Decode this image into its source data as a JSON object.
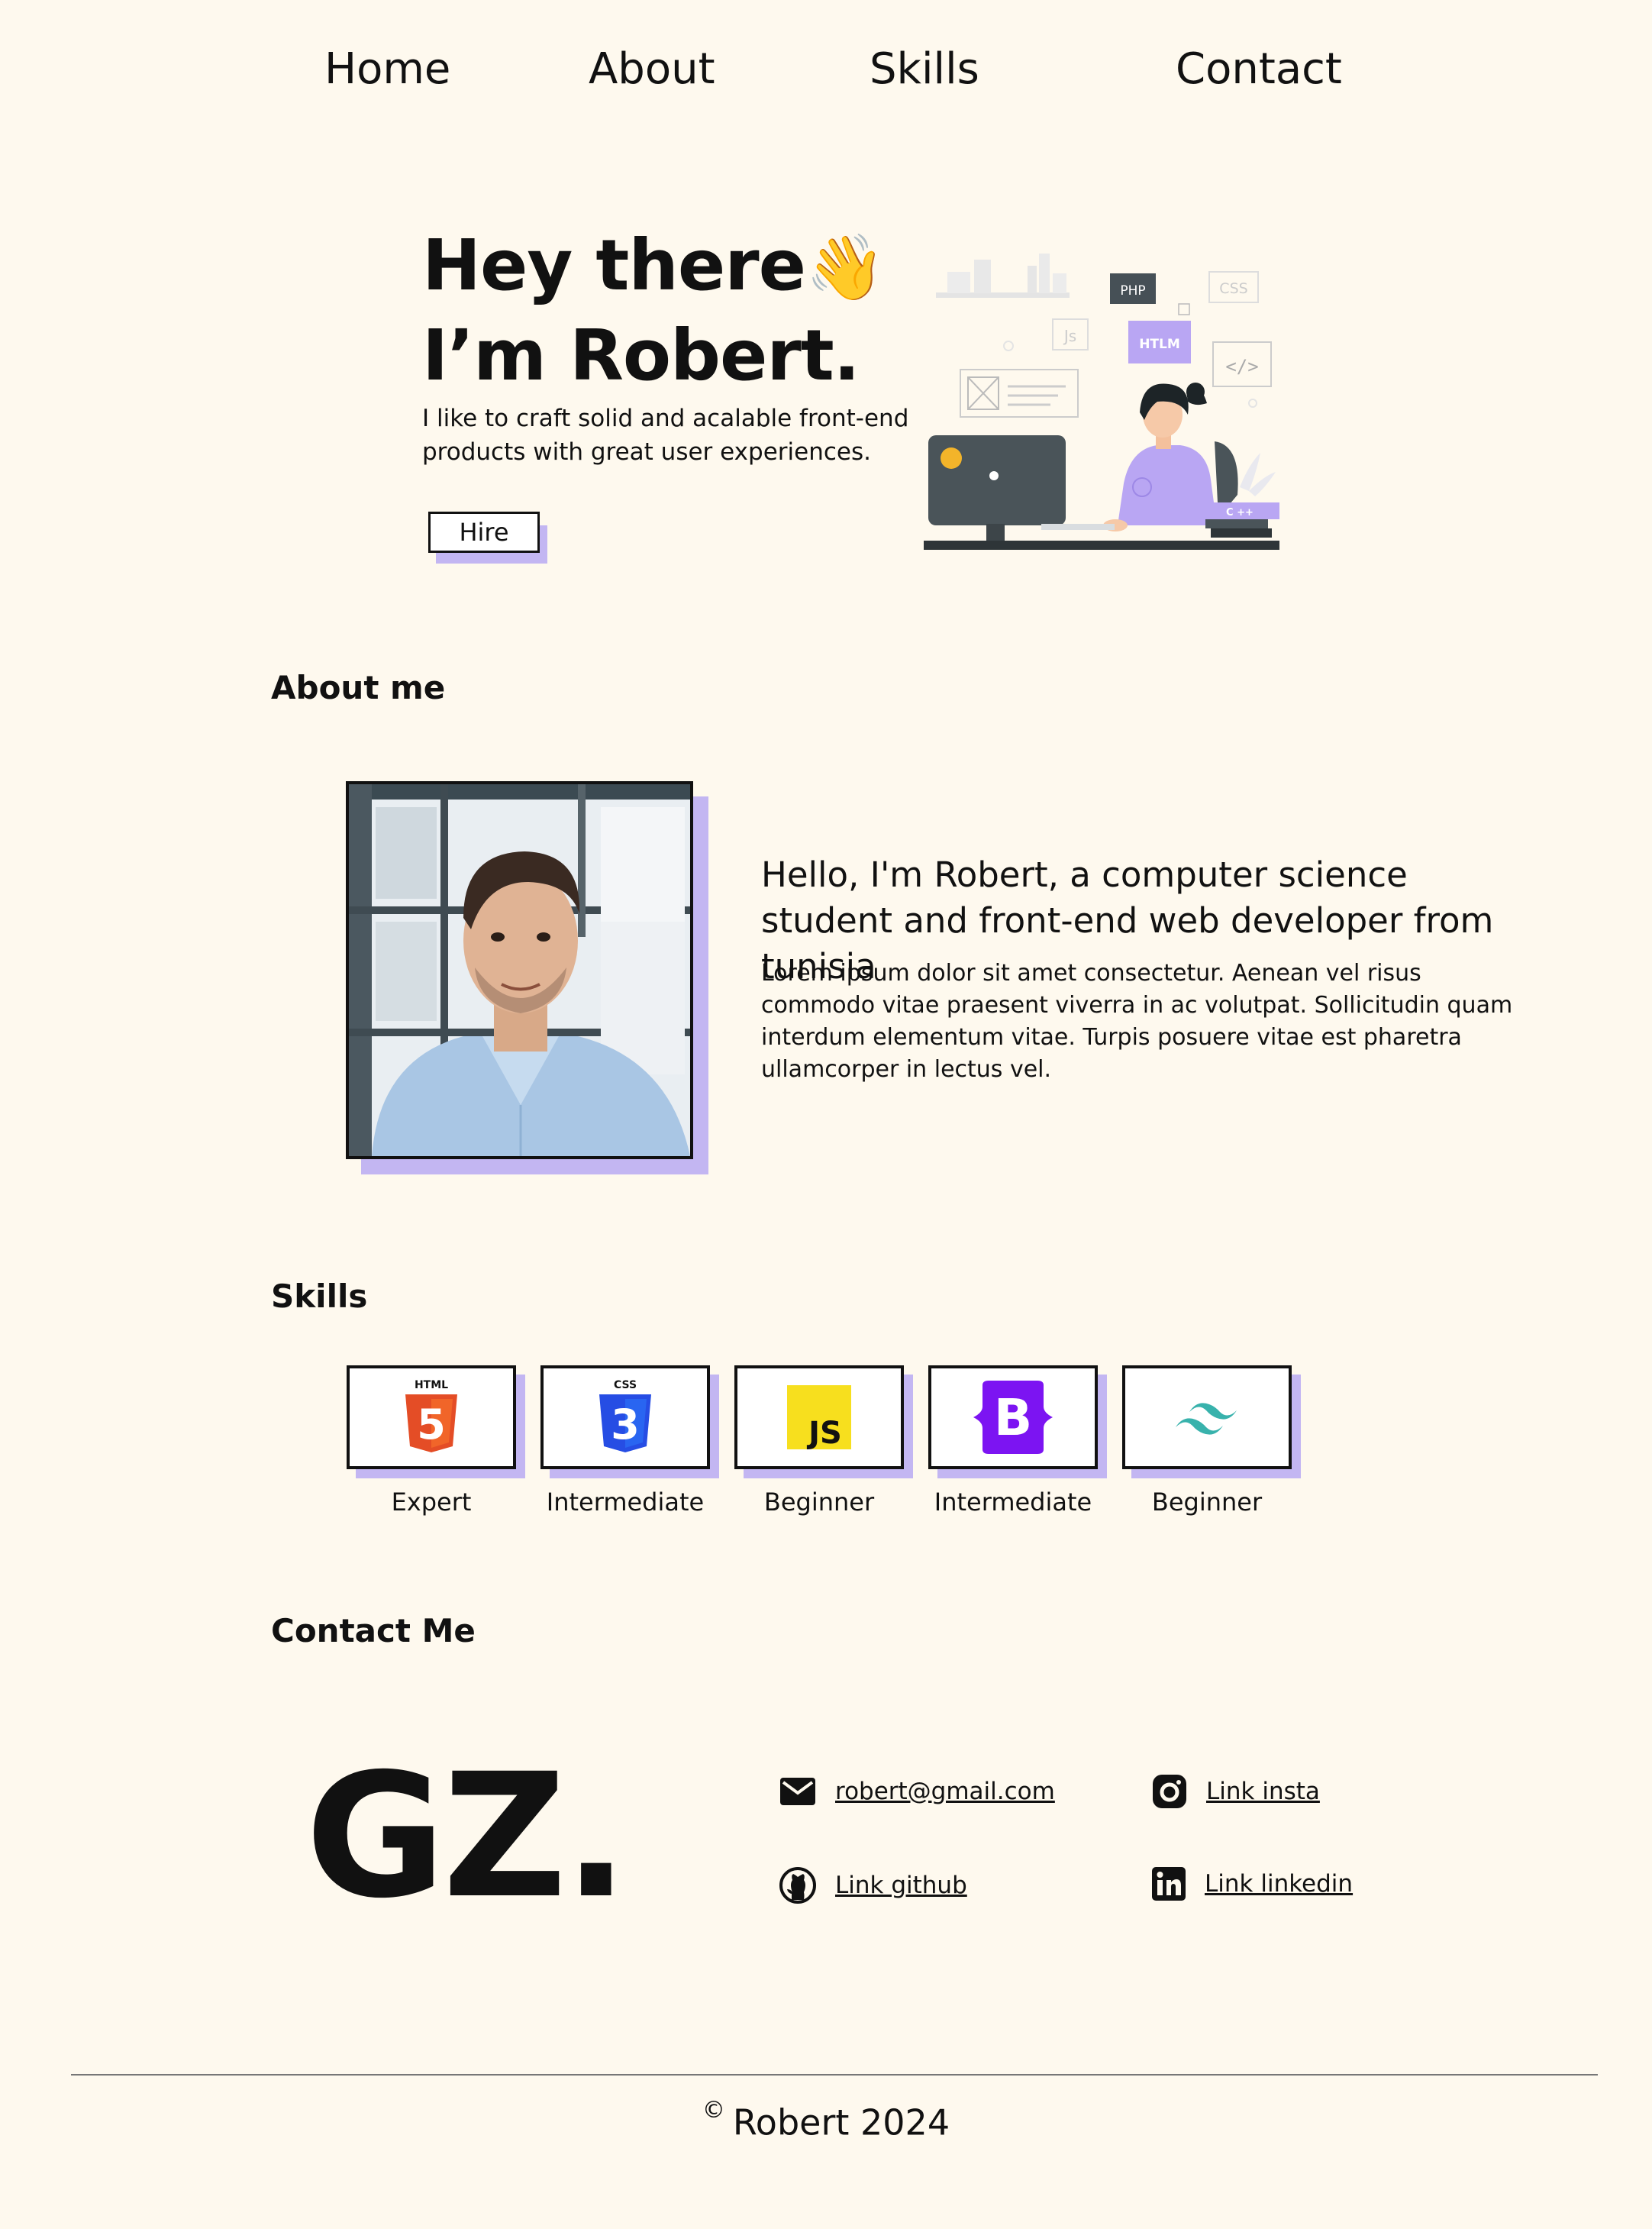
{
  "nav": {
    "home": "Home",
    "about": "About",
    "skills": "Skills",
    "contact": "Contact"
  },
  "hero": {
    "greeting": "Hey there",
    "wave_emoji": "👋",
    "name_line": "I’m Robert.",
    "subtitle": "I like to craft solid and acalable front-end products with great user experiences.",
    "hire_label": "Hire",
    "illustration_labels": {
      "php": "PHP",
      "css": "CSS",
      "js": "Js",
      "htlm": "HTLM",
      "cpp": "C ++"
    }
  },
  "about": {
    "section_title": "About me",
    "heading": "Hello, I'm Robert, a computer science student and front-end web developer from tunisia",
    "body": "Lorem ipsum dolor sit amet consectetur. Aenean vel risus commodo vitae praesent viverra in ac volutpat. Sollicitudin quam interdum elementum vitae. Turpis posuere vitae est pharetra ullamcorper in lectus vel."
  },
  "skills": {
    "section_title": "Skills",
    "items": [
      {
        "icon": "html5-icon",
        "badge": "HTML",
        "level": "Expert",
        "color": "#e44d26"
      },
      {
        "icon": "css3-icon",
        "badge": "CSS",
        "level": "Intermediate",
        "color": "#264de4"
      },
      {
        "icon": "javascript-icon",
        "badge": "JS",
        "level": "Beginner",
        "color": "#f7df1e"
      },
      {
        "icon": "bootstrap-icon",
        "badge": "B",
        "level": "Intermediate",
        "color": "#7c14f2"
      },
      {
        "icon": "tailwind-icon",
        "badge": "",
        "level": "Beginner",
        "color": "#38b2ac"
      }
    ]
  },
  "contact": {
    "section_title": "Contact Me",
    "logo": "GZ.",
    "email": "robert@gmail.com",
    "github": "Link github",
    "insta": "Link insta",
    "linkedin": "Link linkedin"
  },
  "footer": {
    "copyright_symbol": "©",
    "text": "Robert 2024"
  },
  "colors": {
    "background": "#fef9ee",
    "accent_shadow": "#c3b6f2",
    "ink": "#111111"
  }
}
